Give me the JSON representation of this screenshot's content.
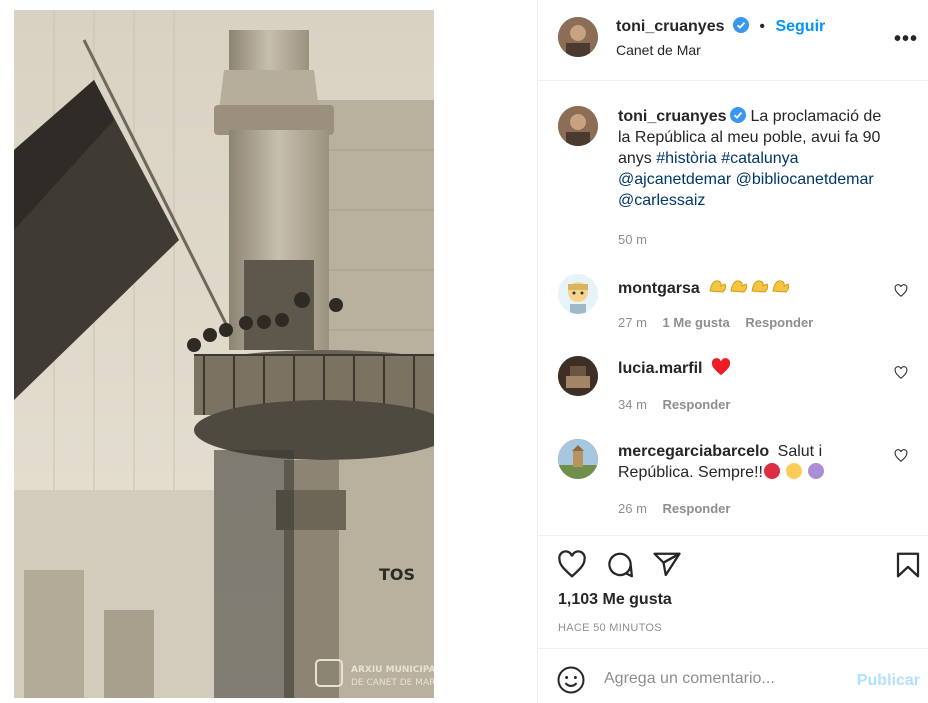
{
  "post": {
    "author": "toni_cruanyes",
    "follow_label": "Seguir",
    "separator": "•",
    "location": "Canet de Mar",
    "more_label": "•••"
  },
  "photo": {
    "watermark_line1": "ARXIU MUNICIPAL",
    "watermark_line2": "DE CANET DE MAR",
    "sign_text": "TOS"
  },
  "caption": {
    "username": "toni_cruanyes",
    "text": "La proclamació de la República al meu poble, avui fa 90 anys",
    "hashtags": [
      "#història",
      "#catalunya"
    ],
    "mentions": [
      "@ajcanetdemar",
      "@bibliocanetdemar",
      "@carlessaiz"
    ],
    "time": "50 m"
  },
  "comments": [
    {
      "username": "montgarsa",
      "text": "",
      "emoji": [
        "flexed-biceps",
        "flexed-biceps",
        "flexed-biceps",
        "flexed-biceps"
      ],
      "time": "27 m",
      "likes": "1 Me gusta",
      "reply": "Responder"
    },
    {
      "username": "lucia.marfil",
      "text": "",
      "emoji": [
        "red-heart"
      ],
      "time": "34 m",
      "reply": "Responder"
    },
    {
      "username": "mercegarciabarcelo",
      "text": "Salut i República. Sempre!!",
      "emoji": [
        "red-circle",
        "yellow-circle",
        "purple-circle"
      ],
      "time": "26 m",
      "reply": "Responder"
    }
  ],
  "actions": {
    "likes": "1,103 Me gusta",
    "timestamp": "HACE 50 MINUTOS"
  },
  "composer": {
    "placeholder": "Agrega un comentario...",
    "publish_label": "Publicar"
  },
  "colors": {
    "accent": "#0095f6",
    "mention": "#00376b",
    "muted": "#8e8e8e",
    "publish_disabled": "#b2dffc",
    "heart_red": "#ed1c24"
  }
}
